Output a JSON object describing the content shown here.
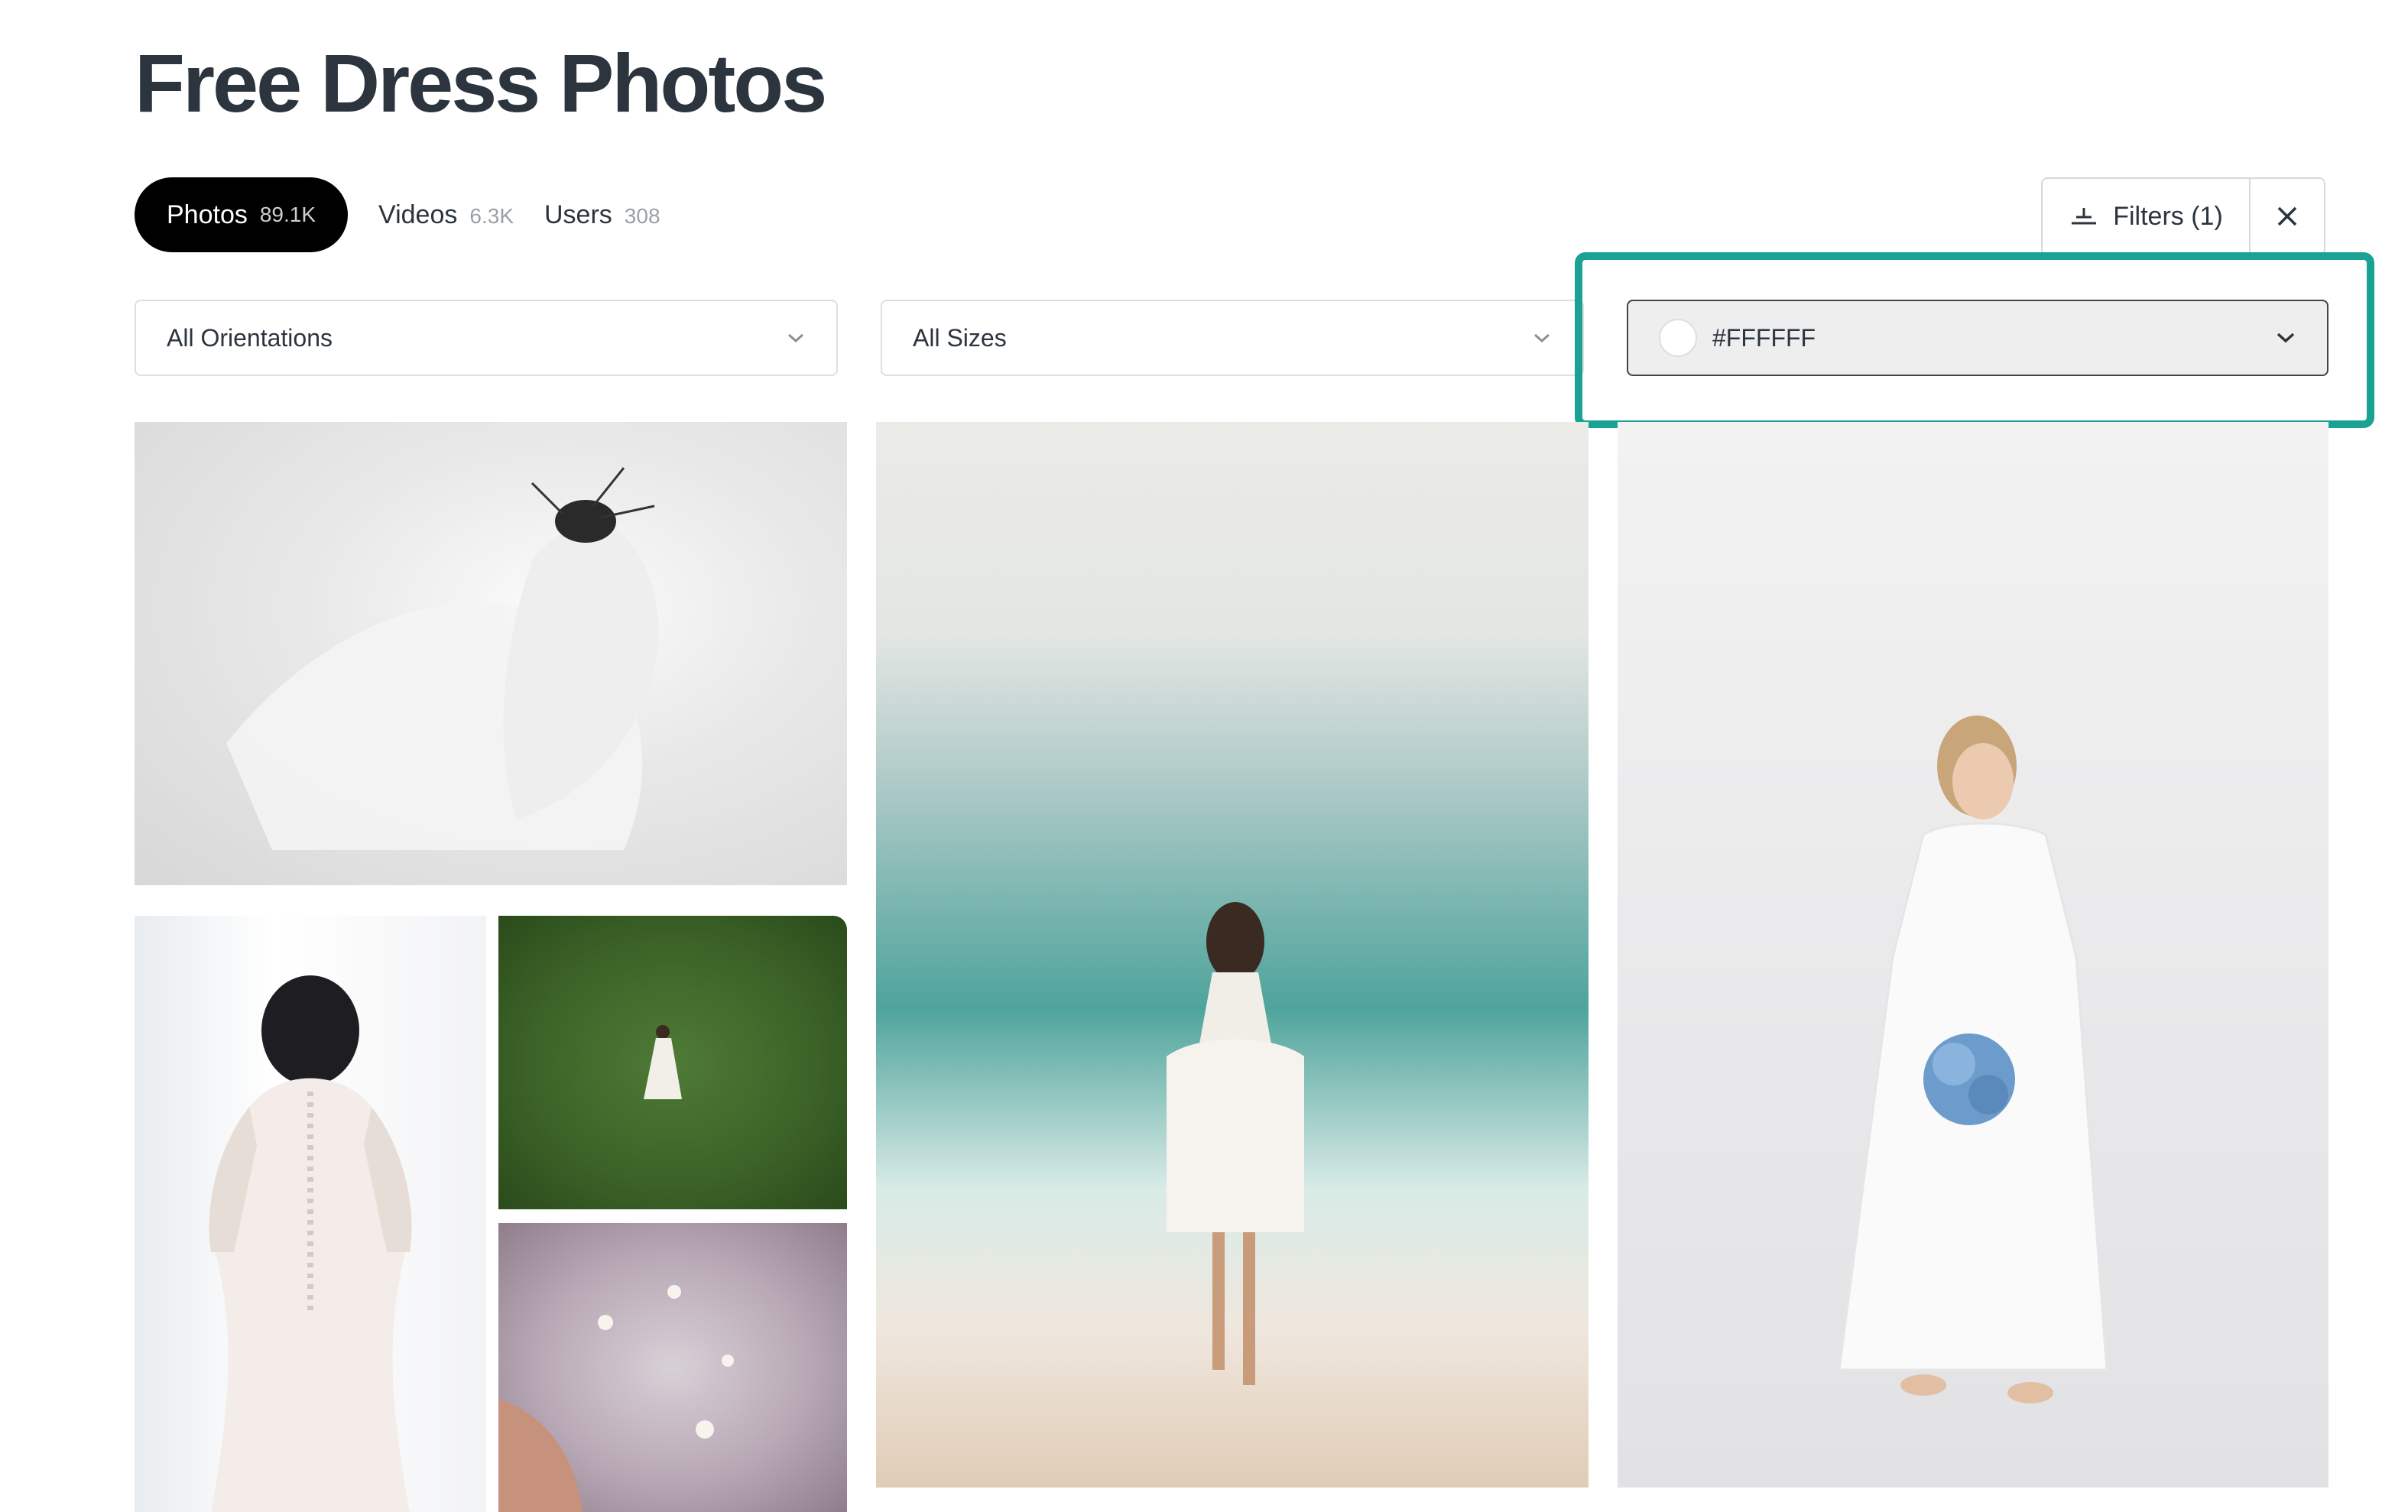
{
  "page": {
    "title": "Free Dress Photos"
  },
  "tabs": [
    {
      "label": "Photos",
      "count": "89.1K"
    },
    {
      "label": "Videos",
      "count": "6.3K"
    },
    {
      "label": "Users",
      "count": "308"
    }
  ],
  "toolbar": {
    "filters_label": "Filters (1)"
  },
  "filters": {
    "orientation": "All Orientations",
    "size": "All Sizes",
    "color": "#FFFFFF"
  },
  "colors": {
    "accent_highlight": "#1aa295",
    "active_tab_bg": "#000000",
    "title_text": "#2c343e"
  },
  "icons": {
    "filters": "sliders-icon",
    "close": "close-icon",
    "dropdown": "chevron-down-icon"
  }
}
